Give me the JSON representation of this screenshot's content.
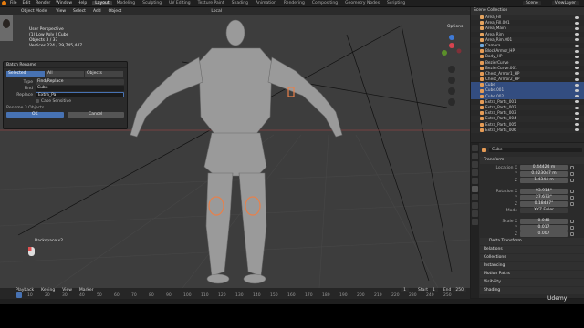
{
  "menu": {
    "items": [
      "File",
      "Edit",
      "Render",
      "Window",
      "Help"
    ],
    "workspaces": [
      "Layout",
      "Modeling",
      "Sculpting",
      "UV Editing",
      "Texture Paint",
      "Shading",
      "Animation",
      "Rendering",
      "Compositing",
      "Geometry Nodes",
      "Scripting"
    ],
    "active_workspace": "Layout",
    "scene": "Scene",
    "view_layer": "ViewLayer"
  },
  "viewport_header": {
    "mode": "Object Mode",
    "menus": [
      "View",
      "Select",
      "Add",
      "Object"
    ],
    "orientation": "Local",
    "options": "Options"
  },
  "overlay_text": {
    "perspective": "User Perspective",
    "collection": "(1) Low Poly | Cube",
    "objects": "Objects   3 / 37",
    "vertices": "Vertices   224 / 29,745,447"
  },
  "dialog": {
    "title": "Batch Rename",
    "tabs": [
      "Selected",
      "All",
      "Objects"
    ],
    "active_tab": "Selected",
    "type_label": "Type",
    "type_value": "Find/Replace",
    "find_label": "Find",
    "find_value": "Cube",
    "replace_label": "Replace",
    "replace_value": "Extra_Pa",
    "case_label": "Case Sensitive",
    "ok": "OK",
    "cancel": "Cancel",
    "status": "Rename 3 Objects"
  },
  "screencast_key": "Backspace x2",
  "outliner": {
    "header": "Scene Collection",
    "rows": [
      {
        "name": "Area_Fill",
        "sel": false,
        "color": "#e5a35e"
      },
      {
        "name": "Area_Fill.001",
        "sel": false,
        "color": "#e5a35e"
      },
      {
        "name": "Area_Main",
        "sel": false,
        "color": "#e5a35e"
      },
      {
        "name": "Area_Rim",
        "sel": false,
        "color": "#e5a35e"
      },
      {
        "name": "Area_Rim.001",
        "sel": false,
        "color": "#e5a35e"
      },
      {
        "name": "Camera",
        "sel": false,
        "color": "#6fa8dc"
      },
      {
        "name": "BlockArmor_HP",
        "sel": false,
        "color": "#e59b55"
      },
      {
        "name": "Body_HP",
        "sel": false,
        "color": "#e59b55"
      },
      {
        "name": "BezierCurve",
        "sel": false,
        "color": "#e59b55"
      },
      {
        "name": "BezierCurve.001",
        "sel": false,
        "color": "#e59b55"
      },
      {
        "name": "Chest_Armor1_HP",
        "sel": false,
        "color": "#e59b55"
      },
      {
        "name": "Chest_Armor2_HP",
        "sel": false,
        "color": "#e59b55"
      },
      {
        "name": "Cube",
        "sel": true,
        "color": "#e59b55"
      },
      {
        "name": "Cube.001",
        "sel": true,
        "color": "#e59b55"
      },
      {
        "name": "Cube.002",
        "sel": true,
        "color": "#e59b55"
      },
      {
        "name": "Extra_Parts_001",
        "sel": false,
        "color": "#e59b55"
      },
      {
        "name": "Extra_Parts_002",
        "sel": false,
        "color": "#e59b55"
      },
      {
        "name": "Extra_Parts_003",
        "sel": false,
        "color": "#e59b55"
      },
      {
        "name": "Extra_Parts_004",
        "sel": false,
        "color": "#e59b55"
      },
      {
        "name": "Extra_Parts_005",
        "sel": false,
        "color": "#e59b55"
      },
      {
        "name": "Extra_Parts_006",
        "sel": false,
        "color": "#e59b55"
      }
    ]
  },
  "properties": {
    "object_name": "Cube",
    "transform_header": "Transform",
    "location_label": "Location X",
    "location": [
      "0.44424 m",
      "0.023047 m",
      "1.4344 m"
    ],
    "rotation_label": "Rotation X",
    "rotation": [
      "93.914°",
      "27.673°",
      "0.18437°"
    ],
    "mode_label": "Mode",
    "mode_value": "XYZ Euler",
    "scale_label": "Scale X",
    "scale": [
      "0.048",
      "0.017",
      "0.007"
    ],
    "axis_labels": [
      "Y",
      "Z"
    ],
    "sections": [
      "Delta Transform",
      "Relations",
      "Collections",
      "Instancing",
      "Motion Paths",
      "Visibility",
      "Shading"
    ]
  },
  "timeline": {
    "menus": [
      "Playback",
      "Keying",
      "View",
      "Marker"
    ],
    "ticks": [
      "10",
      "20",
      "30",
      "40",
      "50",
      "60",
      "70",
      "80",
      "90",
      "100",
      "110",
      "120",
      "130",
      "140",
      "150",
      "160",
      "170",
      "180",
      "190",
      "200",
      "210",
      "220",
      "230",
      "240",
      "250"
    ],
    "current_frame": "1",
    "start_label": "Start",
    "start": "1",
    "end_label": "End",
    "end": "250"
  },
  "watermark": "Udemy"
}
